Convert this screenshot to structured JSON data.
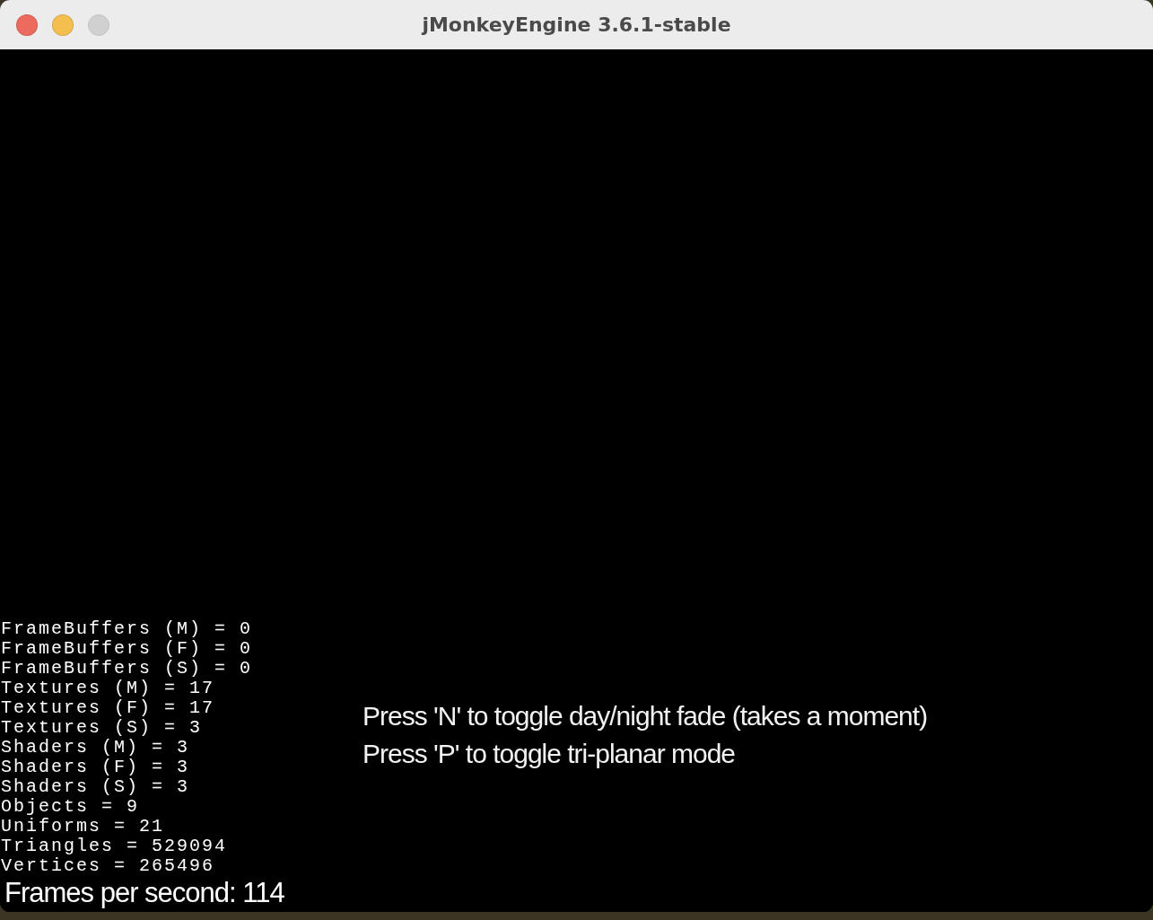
{
  "window": {
    "title": "jMonkeyEngine 3.6.1-stable",
    "buttons": [
      {
        "kind": "close",
        "disabled": false
      },
      {
        "kind": "minimize",
        "disabled": false
      },
      {
        "kind": "zoom",
        "disabled": true
      }
    ]
  },
  "stats": [
    "FrameBuffers (M) = 0",
    "FrameBuffers (F) = 0",
    "FrameBuffers (S) = 0",
    "Textures (M) = 17",
    "Textures (F) = 17",
    "Textures (S) = 3",
    "Shaders (M) = 3",
    "Shaders (F) = 3",
    "Shaders (S) = 3",
    "Objects = 9",
    "Uniforms = 21",
    "Triangles = 529094",
    "Vertices = 265496"
  ],
  "hints": [
    "Press 'N' to toggle day/night fade (takes a moment)",
    "Press 'P' to toggle tri-planar mode"
  ],
  "fps": "Frames per second: 114"
}
